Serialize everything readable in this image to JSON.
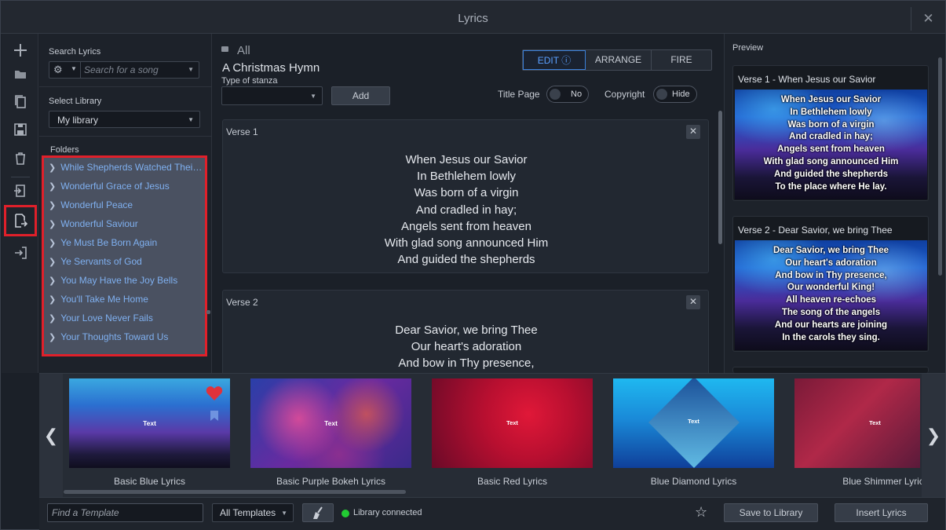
{
  "window": {
    "title": "Lyrics",
    "close_glyph": "✕"
  },
  "rail": {
    "tools": [
      {
        "icon": "plus-icon"
      },
      {
        "icon": "folder-icon"
      },
      {
        "icon": "copy-icon"
      },
      {
        "icon": "save-icon"
      },
      {
        "icon": "trash-icon"
      },
      {
        "icon": "import-icon"
      },
      {
        "icon": "export-icon",
        "active": true
      },
      {
        "icon": "sign-in-icon"
      }
    ]
  },
  "library": {
    "search_label": "Search Lyrics",
    "search_placeholder": "Search for a song",
    "select_library_label": "Select Library",
    "library_value": "My library",
    "folders_label": "Folders",
    "folders": [
      "While Shepherds Watched Their Flocks",
      "Wonderful Grace of Jesus",
      "Wonderful Peace",
      "Wonderful Saviour",
      "Ye Must Be Born Again",
      "Ye Servants of God",
      "You May Have the Joy Bells",
      "You'll Take Me Home",
      "Your Love Never Fails",
      "Your Thoughts Toward Us"
    ]
  },
  "editor": {
    "crumb": "All",
    "song_title": "A Christmas Hymn",
    "stanza_label": "Type of stanza",
    "stanza_value": "",
    "add_label": "Add",
    "modes": {
      "edit": "EDIT ⓘ",
      "arrange": "ARRANGE",
      "fire": "FIRE",
      "active": "edit"
    },
    "title_page_label": "Title Page",
    "title_page_value": "No",
    "copyright_label": "Copyright",
    "copyright_value": "Hide",
    "verses": [
      {
        "heading": "Verse 1",
        "lines": [
          "When Jesus our Savior",
          "In Bethlehem lowly",
          "Was born of a virgin",
          "And cradled in hay;",
          "Angels sent from heaven",
          "With glad song announced Him",
          "And guided the shepherds"
        ]
      },
      {
        "heading": "Verse 2",
        "lines": [
          "Dear Savior, we bring Thee",
          "Our heart's adoration",
          "And bow in Thy presence,"
        ]
      }
    ]
  },
  "preview": {
    "label": "Preview",
    "cards": [
      {
        "heading": "Verse 1 - When Jesus our Savior",
        "lines": [
          "When Jesus our Savior",
          "In Bethlehem lowly",
          "Was born of a virgin",
          "And cradled in hay;",
          "Angels sent from heaven",
          "With glad song announced Him",
          "And guided the shepherds",
          "To the place where He lay."
        ]
      },
      {
        "heading": "Verse 2 - Dear Savior, we bring Thee",
        "lines": [
          "Dear Savior, we bring Thee",
          "Our heart's adoration",
          "And bow in Thy presence,",
          "Our wonderful King!",
          "All heaven re-echoes",
          "The song of the angels",
          "And our hearts are joining",
          "In the carols they sing."
        ]
      }
    ]
  },
  "templates": {
    "items": [
      {
        "name": "Basic Blue Lyrics",
        "thumb_text": "Text",
        "favorite": true,
        "bookmarked": true
      },
      {
        "name": "Basic Purple Bokeh Lyrics",
        "thumb_text": "Text"
      },
      {
        "name": "Basic Red Lyrics",
        "thumb_text": "Text"
      },
      {
        "name": "Blue Diamond Lyrics",
        "thumb_text": "Text"
      },
      {
        "name": "Blue Shimmer Lyrics",
        "thumb_text": "Text"
      }
    ],
    "prev_glyph": "❮",
    "next_glyph": "❯"
  },
  "footer": {
    "find_placeholder": "Find a Template",
    "filter_value": "All Templates",
    "status_text": "Library connected",
    "status_color": "#22cc33",
    "save_label": "Save to Library",
    "insert_label": "Insert Lyrics"
  },
  "colors": {
    "accent": "#3a7fd9",
    "highlight_box": "#e0202a",
    "folder_link": "#7fb0f0"
  }
}
